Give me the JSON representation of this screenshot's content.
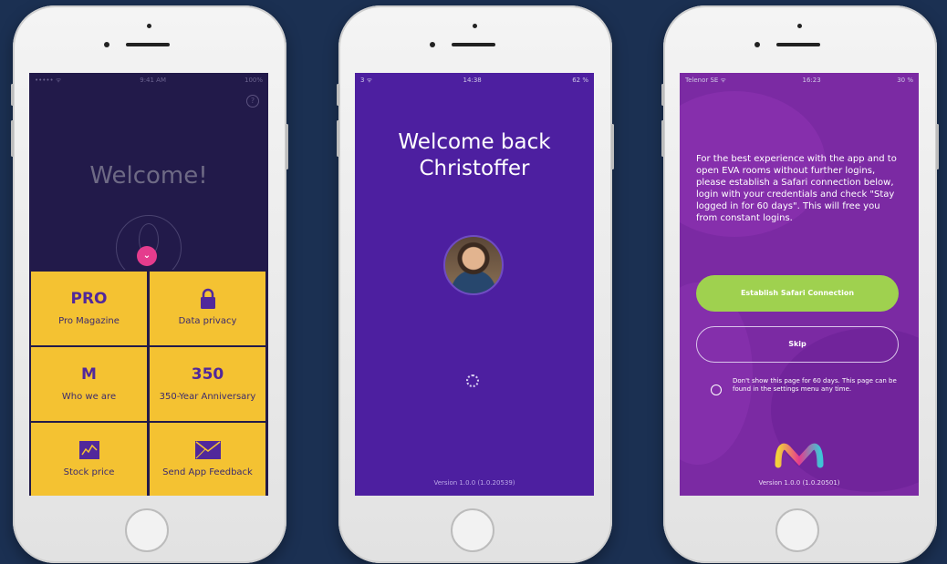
{
  "phone1": {
    "status": {
      "left": "••••• ᯤ",
      "time": "9:41 AM",
      "right": "100%"
    },
    "help": "?",
    "title": "Welcome!",
    "tiles": [
      {
        "icon": "pro-logo-icon",
        "glyph": "PRO",
        "label": "Pro Magazine"
      },
      {
        "icon": "lock-icon",
        "glyph": "",
        "label": "Data privacy"
      },
      {
        "icon": "m-logo-icon",
        "glyph": "M",
        "label": "Who we are"
      },
      {
        "icon": "350-icon",
        "glyph": "350",
        "label": "350-Year Anniversary"
      },
      {
        "icon": "chart-icon",
        "glyph": "",
        "label": "Stock price"
      },
      {
        "icon": "envelope-icon",
        "glyph": "",
        "label": "Send App Feedback"
      }
    ]
  },
  "phone2": {
    "status": {
      "left": "3 ᯤ",
      "time": "14:38",
      "right": "62 %"
    },
    "title_line1": "Welcome back",
    "title_line2": "Christoffer",
    "version": "Version 1.0.0 (1.0.20539)"
  },
  "phone3": {
    "status": {
      "left": "Telenor SE ᯤ",
      "time": "16:23",
      "right": "30 %"
    },
    "intro": "For the best experience with the app and to open EVA rooms without further logins, please establish a Safari connection below, login with your credentials and check \"Stay logged in for 60 days\". This will free you from constant logins.",
    "safari_button": "Establish Safari Connection",
    "skip_button": "Skip",
    "checkbox_text": "Don't show this page for 60 days. This page can be found in the settings menu any time.",
    "version": "Version 1.0.0 (1.0.20501)"
  },
  "colors": {
    "background": "#1b3052",
    "tile": "#f4c232",
    "purple": "#4d1fa0",
    "green": "#9fd14f",
    "pink": "#e53c8d"
  }
}
